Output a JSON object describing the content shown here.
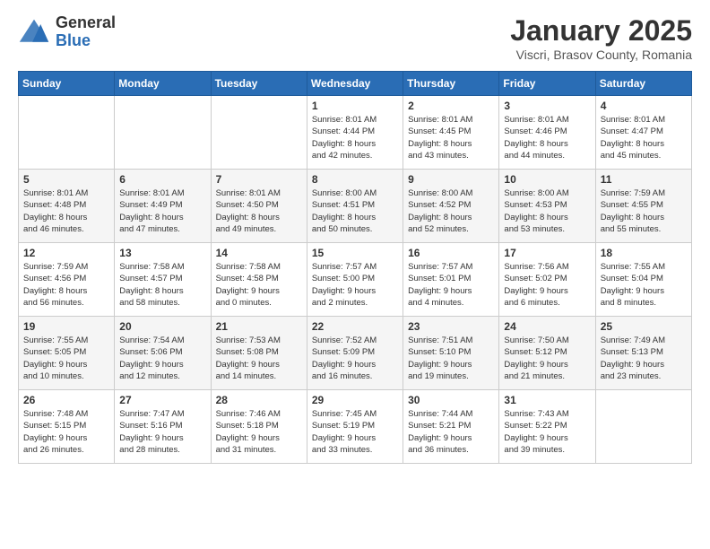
{
  "logo": {
    "general": "General",
    "blue": "Blue"
  },
  "title": "January 2025",
  "subtitle": "Viscri, Brasov County, Romania",
  "days": {
    "headers": [
      "Sunday",
      "Monday",
      "Tuesday",
      "Wednesday",
      "Thursday",
      "Friday",
      "Saturday"
    ]
  },
  "weeks": [
    [
      {
        "num": "",
        "info": ""
      },
      {
        "num": "",
        "info": ""
      },
      {
        "num": "",
        "info": ""
      },
      {
        "num": "1",
        "info": "Sunrise: 8:01 AM\nSunset: 4:44 PM\nDaylight: 8 hours\nand 42 minutes."
      },
      {
        "num": "2",
        "info": "Sunrise: 8:01 AM\nSunset: 4:45 PM\nDaylight: 8 hours\nand 43 minutes."
      },
      {
        "num": "3",
        "info": "Sunrise: 8:01 AM\nSunset: 4:46 PM\nDaylight: 8 hours\nand 44 minutes."
      },
      {
        "num": "4",
        "info": "Sunrise: 8:01 AM\nSunset: 4:47 PM\nDaylight: 8 hours\nand 45 minutes."
      }
    ],
    [
      {
        "num": "5",
        "info": "Sunrise: 8:01 AM\nSunset: 4:48 PM\nDaylight: 8 hours\nand 46 minutes."
      },
      {
        "num": "6",
        "info": "Sunrise: 8:01 AM\nSunset: 4:49 PM\nDaylight: 8 hours\nand 47 minutes."
      },
      {
        "num": "7",
        "info": "Sunrise: 8:01 AM\nSunset: 4:50 PM\nDaylight: 8 hours\nand 49 minutes."
      },
      {
        "num": "8",
        "info": "Sunrise: 8:00 AM\nSunset: 4:51 PM\nDaylight: 8 hours\nand 50 minutes."
      },
      {
        "num": "9",
        "info": "Sunrise: 8:00 AM\nSunset: 4:52 PM\nDaylight: 8 hours\nand 52 minutes."
      },
      {
        "num": "10",
        "info": "Sunrise: 8:00 AM\nSunset: 4:53 PM\nDaylight: 8 hours\nand 53 minutes."
      },
      {
        "num": "11",
        "info": "Sunrise: 7:59 AM\nSunset: 4:55 PM\nDaylight: 8 hours\nand 55 minutes."
      }
    ],
    [
      {
        "num": "12",
        "info": "Sunrise: 7:59 AM\nSunset: 4:56 PM\nDaylight: 8 hours\nand 56 minutes."
      },
      {
        "num": "13",
        "info": "Sunrise: 7:58 AM\nSunset: 4:57 PM\nDaylight: 8 hours\nand 58 minutes."
      },
      {
        "num": "14",
        "info": "Sunrise: 7:58 AM\nSunset: 4:58 PM\nDaylight: 9 hours\nand 0 minutes."
      },
      {
        "num": "15",
        "info": "Sunrise: 7:57 AM\nSunset: 5:00 PM\nDaylight: 9 hours\nand 2 minutes."
      },
      {
        "num": "16",
        "info": "Sunrise: 7:57 AM\nSunset: 5:01 PM\nDaylight: 9 hours\nand 4 minutes."
      },
      {
        "num": "17",
        "info": "Sunrise: 7:56 AM\nSunset: 5:02 PM\nDaylight: 9 hours\nand 6 minutes."
      },
      {
        "num": "18",
        "info": "Sunrise: 7:55 AM\nSunset: 5:04 PM\nDaylight: 9 hours\nand 8 minutes."
      }
    ],
    [
      {
        "num": "19",
        "info": "Sunrise: 7:55 AM\nSunset: 5:05 PM\nDaylight: 9 hours\nand 10 minutes."
      },
      {
        "num": "20",
        "info": "Sunrise: 7:54 AM\nSunset: 5:06 PM\nDaylight: 9 hours\nand 12 minutes."
      },
      {
        "num": "21",
        "info": "Sunrise: 7:53 AM\nSunset: 5:08 PM\nDaylight: 9 hours\nand 14 minutes."
      },
      {
        "num": "22",
        "info": "Sunrise: 7:52 AM\nSunset: 5:09 PM\nDaylight: 9 hours\nand 16 minutes."
      },
      {
        "num": "23",
        "info": "Sunrise: 7:51 AM\nSunset: 5:10 PM\nDaylight: 9 hours\nand 19 minutes."
      },
      {
        "num": "24",
        "info": "Sunrise: 7:50 AM\nSunset: 5:12 PM\nDaylight: 9 hours\nand 21 minutes."
      },
      {
        "num": "25",
        "info": "Sunrise: 7:49 AM\nSunset: 5:13 PM\nDaylight: 9 hours\nand 23 minutes."
      }
    ],
    [
      {
        "num": "26",
        "info": "Sunrise: 7:48 AM\nSunset: 5:15 PM\nDaylight: 9 hours\nand 26 minutes."
      },
      {
        "num": "27",
        "info": "Sunrise: 7:47 AM\nSunset: 5:16 PM\nDaylight: 9 hours\nand 28 minutes."
      },
      {
        "num": "28",
        "info": "Sunrise: 7:46 AM\nSunset: 5:18 PM\nDaylight: 9 hours\nand 31 minutes."
      },
      {
        "num": "29",
        "info": "Sunrise: 7:45 AM\nSunset: 5:19 PM\nDaylight: 9 hours\nand 33 minutes."
      },
      {
        "num": "30",
        "info": "Sunrise: 7:44 AM\nSunset: 5:21 PM\nDaylight: 9 hours\nand 36 minutes."
      },
      {
        "num": "31",
        "info": "Sunrise: 7:43 AM\nSunset: 5:22 PM\nDaylight: 9 hours\nand 39 minutes."
      },
      {
        "num": "",
        "info": ""
      }
    ]
  ]
}
